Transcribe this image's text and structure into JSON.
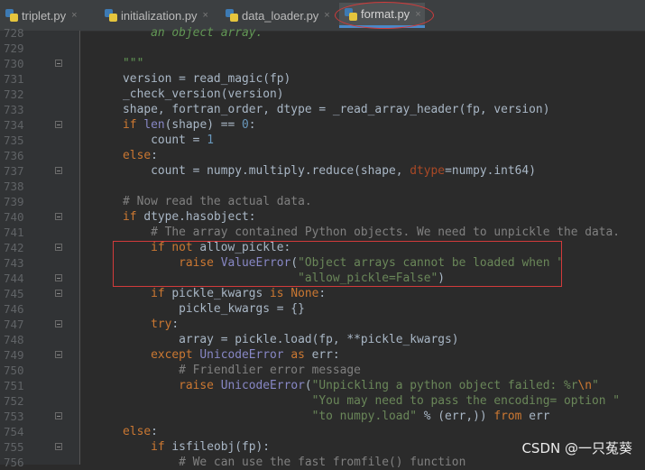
{
  "tabs": [
    {
      "label": "triplet.py",
      "active": false
    },
    {
      "label": "initialization.py",
      "active": false
    },
    {
      "label": "data_loader.py",
      "active": false
    },
    {
      "label": "format.py",
      "active": true
    }
  ],
  "tab_close_glyph": "×",
  "editor": {
    "lines": [
      {
        "n": "728",
        "fold": false,
        "tokens": [
          [
            "doc",
            "        an object array."
          ]
        ]
      },
      {
        "n": "729",
        "fold": false,
        "tokens": []
      },
      {
        "n": "730",
        "fold": true,
        "tokens": [
          [
            "doc",
            "    \"\"\""
          ]
        ]
      },
      {
        "n": "731",
        "fold": false,
        "tokens": [
          [
            "p",
            "    version = read_magic(fp)"
          ]
        ]
      },
      {
        "n": "732",
        "fold": false,
        "tokens": [
          [
            "p",
            "    _check_version(version)"
          ]
        ]
      },
      {
        "n": "733",
        "fold": false,
        "tokens": [
          [
            "p",
            "    shape, fortran_order, dtype = _read_array_header(fp, version)"
          ]
        ]
      },
      {
        "n": "734",
        "fold": true,
        "tokens": [
          [
            "p",
            "    "
          ],
          [
            "kw",
            "if "
          ],
          [
            "bi",
            "len"
          ],
          [
            "p",
            "(shape) == "
          ],
          [
            "num",
            "0"
          ],
          [
            "p",
            ":"
          ]
        ]
      },
      {
        "n": "735",
        "fold": false,
        "tokens": [
          [
            "p",
            "        count = "
          ],
          [
            "num",
            "1"
          ]
        ]
      },
      {
        "n": "736",
        "fold": false,
        "tokens": [
          [
            "p",
            "    "
          ],
          [
            "kw",
            "else"
          ],
          [
            "p",
            ":"
          ]
        ]
      },
      {
        "n": "737",
        "fold": true,
        "tokens": [
          [
            "p",
            "        count = numpy.multiply.reduce(shape, "
          ],
          [
            "par",
            "dtype"
          ],
          [
            "p",
            "=numpy.int64)"
          ]
        ]
      },
      {
        "n": "738",
        "fold": false,
        "tokens": []
      },
      {
        "n": "739",
        "fold": false,
        "tokens": [
          [
            "cm",
            "    # Now read the actual data."
          ]
        ]
      },
      {
        "n": "740",
        "fold": true,
        "tokens": [
          [
            "p",
            "    "
          ],
          [
            "kw",
            "if "
          ],
          [
            "p",
            "dtype.hasobject:"
          ]
        ]
      },
      {
        "n": "741",
        "fold": false,
        "tokens": [
          [
            "cm",
            "        # The array contained Python objects. We need to unpickle the data."
          ]
        ]
      },
      {
        "n": "742",
        "fold": true,
        "tokens": [
          [
            "p",
            "        "
          ],
          [
            "kw",
            "if not "
          ],
          [
            "p",
            "allow_pickle:"
          ]
        ]
      },
      {
        "n": "743",
        "fold": false,
        "tokens": [
          [
            "p",
            "            "
          ],
          [
            "kw",
            "raise "
          ],
          [
            "bi",
            "ValueError"
          ],
          [
            "p",
            "("
          ],
          [
            "str",
            "\"Object arrays cannot be loaded when \""
          ]
        ]
      },
      {
        "n": "744",
        "fold": true,
        "tokens": [
          [
            "p",
            "                             "
          ],
          [
            "str",
            "\"allow_pickle=False\""
          ],
          [
            "p",
            ")"
          ]
        ]
      },
      {
        "n": "745",
        "fold": true,
        "tokens": [
          [
            "p",
            "        "
          ],
          [
            "kw",
            "if "
          ],
          [
            "p",
            "pickle_kwargs "
          ],
          [
            "kw",
            "is None"
          ],
          [
            "p",
            ":"
          ]
        ]
      },
      {
        "n": "746",
        "fold": false,
        "tokens": [
          [
            "p",
            "            pickle_kwargs = {}"
          ]
        ]
      },
      {
        "n": "747",
        "fold": true,
        "tokens": [
          [
            "p",
            "        "
          ],
          [
            "kw",
            "try"
          ],
          [
            "p",
            ":"
          ]
        ]
      },
      {
        "n": "748",
        "fold": false,
        "tokens": [
          [
            "p",
            "            array = pickle.load(fp, **pickle_kwargs)"
          ]
        ]
      },
      {
        "n": "749",
        "fold": true,
        "tokens": [
          [
            "p",
            "        "
          ],
          [
            "kw",
            "except "
          ],
          [
            "bi",
            "UnicodeError "
          ],
          [
            "kw",
            "as "
          ],
          [
            "p",
            "err:"
          ]
        ]
      },
      {
        "n": "750",
        "fold": false,
        "tokens": [
          [
            "cm",
            "            # Friendlier error message"
          ]
        ]
      },
      {
        "n": "751",
        "fold": false,
        "tokens": [
          [
            "p",
            "            "
          ],
          [
            "kw",
            "raise "
          ],
          [
            "bi",
            "UnicodeError"
          ],
          [
            "p",
            "("
          ],
          [
            "str",
            "\"Unpickling a python object failed: %r"
          ],
          [
            "esc",
            "\\n"
          ],
          [
            "str",
            "\""
          ]
        ]
      },
      {
        "n": "752",
        "fold": false,
        "tokens": [
          [
            "p",
            "                               "
          ],
          [
            "str",
            "\"You may need to pass the encoding= option \""
          ]
        ]
      },
      {
        "n": "753",
        "fold": true,
        "tokens": [
          [
            "p",
            "                               "
          ],
          [
            "str",
            "\"to numpy.load\""
          ],
          [
            "p",
            " % (err,)) "
          ],
          [
            "kw",
            "from "
          ],
          [
            "p",
            "err"
          ]
        ]
      },
      {
        "n": "754",
        "fold": false,
        "tokens": [
          [
            "p",
            "    "
          ],
          [
            "kw",
            "else"
          ],
          [
            "p",
            ":"
          ]
        ]
      },
      {
        "n": "755",
        "fold": true,
        "tokens": [
          [
            "p",
            "        "
          ],
          [
            "kw",
            "if "
          ],
          [
            "p",
            "isfileobj(fp):"
          ]
        ]
      },
      {
        "n": "756",
        "fold": false,
        "tokens": [
          [
            "cm",
            "            # We can use the fast fromfile() function"
          ]
        ]
      }
    ]
  },
  "watermark": "CSDN @一只菟葵",
  "colors": {
    "keyword": "#cc7832",
    "string": "#6a8759",
    "comment": "#808080",
    "number": "#6897bb",
    "builtin": "#8888c6",
    "param": "#aa4926",
    "annotation_red": "#d23b3b"
  }
}
